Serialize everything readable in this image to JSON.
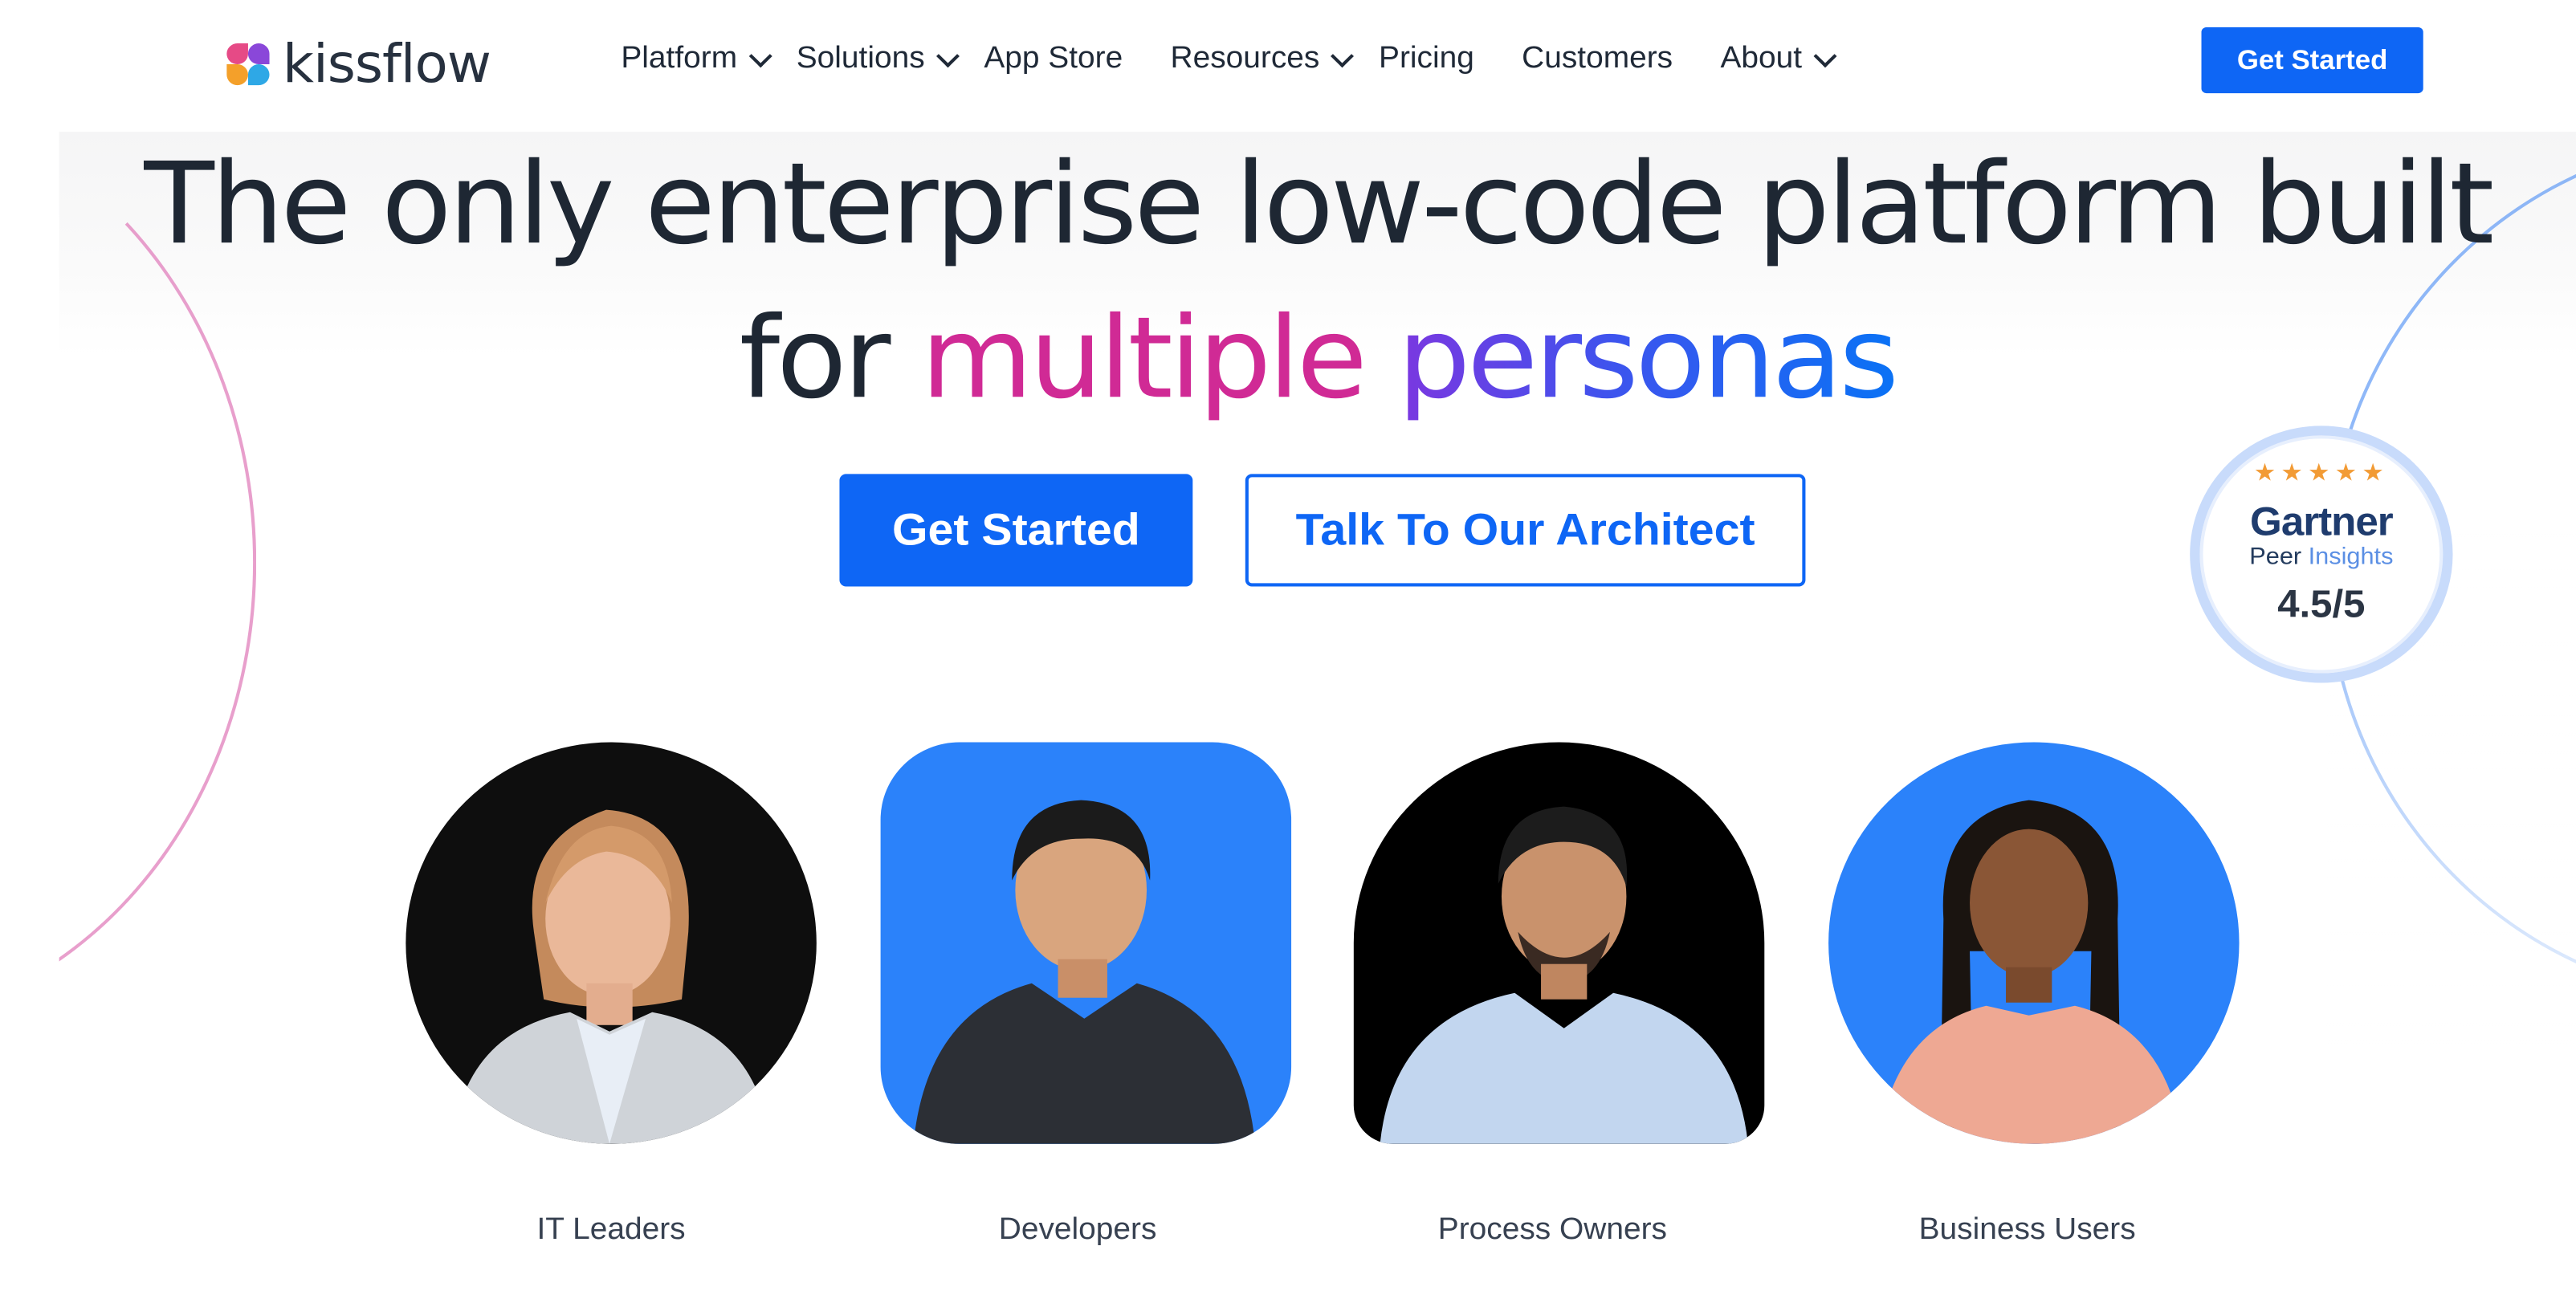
{
  "brand": {
    "name": "kissflow"
  },
  "nav": {
    "items": [
      {
        "label": "Platform",
        "has_dropdown": true
      },
      {
        "label": "Solutions",
        "has_dropdown": true
      },
      {
        "label": "App Store",
        "has_dropdown": false
      },
      {
        "label": "Resources",
        "has_dropdown": true
      },
      {
        "label": "Pricing",
        "has_dropdown": false
      },
      {
        "label": "Customers",
        "has_dropdown": false
      },
      {
        "label": "About",
        "has_dropdown": true
      }
    ],
    "cta_label": "Get Started"
  },
  "hero": {
    "line1": "The only enterprise low-code platform built",
    "line2_prefix": "for ",
    "line2_highlight_1": "multiple",
    "line2_highlight_2": "personas",
    "primary_button": "Get Started",
    "secondary_button": "Talk To Our Architect"
  },
  "badge": {
    "stars": "★★★★★",
    "brand": "Gartner",
    "sub_dark": "Peer ",
    "sub_light": "Insights",
    "score": "4.5/5"
  },
  "personas": [
    {
      "label": "IT Leaders"
    },
    {
      "label": "Developers"
    },
    {
      "label": "Process Owners"
    },
    {
      "label": "Business Users"
    }
  ],
  "colors": {
    "accent": "#0e66f5",
    "highlight_pink": "#d02a95",
    "highlight_purple": "#7b37e0",
    "persona_blue": "#2b82fa",
    "text_dark": "#1e2733"
  }
}
